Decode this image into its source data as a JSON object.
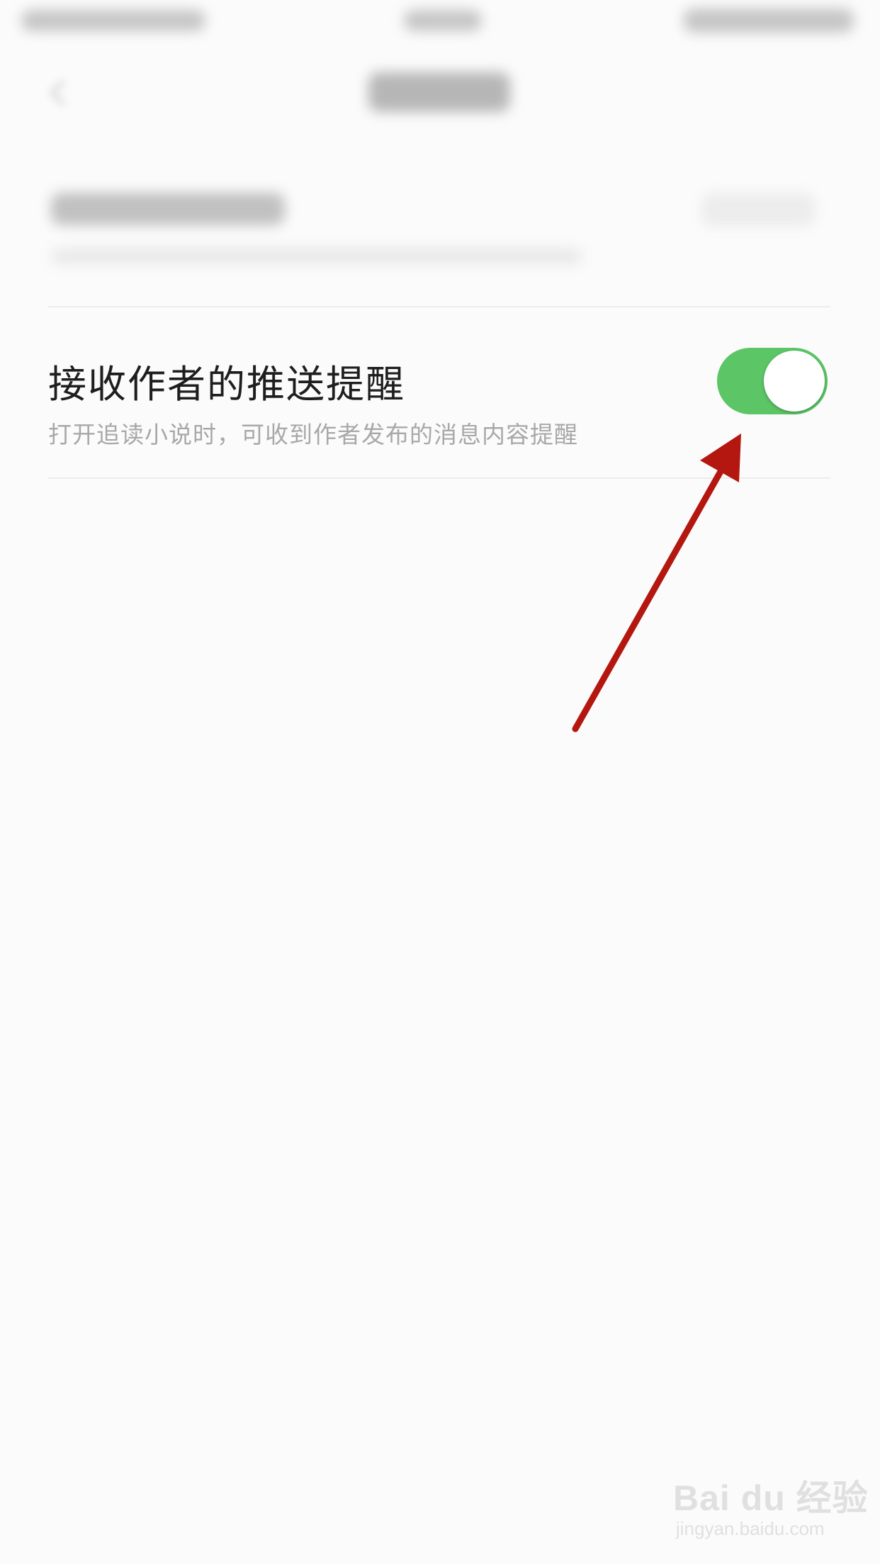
{
  "settings": {
    "push_reminder": {
      "title": "接收作者的推送提醒",
      "description": "打开追读小说时，可收到作者发布的消息内容提醒",
      "toggle_state": "on"
    }
  },
  "watermark": {
    "logo_text": "Bai du 经验",
    "url": "jingyan.baidu.com"
  },
  "colors": {
    "toggle_on": "#5cc566",
    "arrow": "#b3170f",
    "background": "#fbfbfb"
  }
}
